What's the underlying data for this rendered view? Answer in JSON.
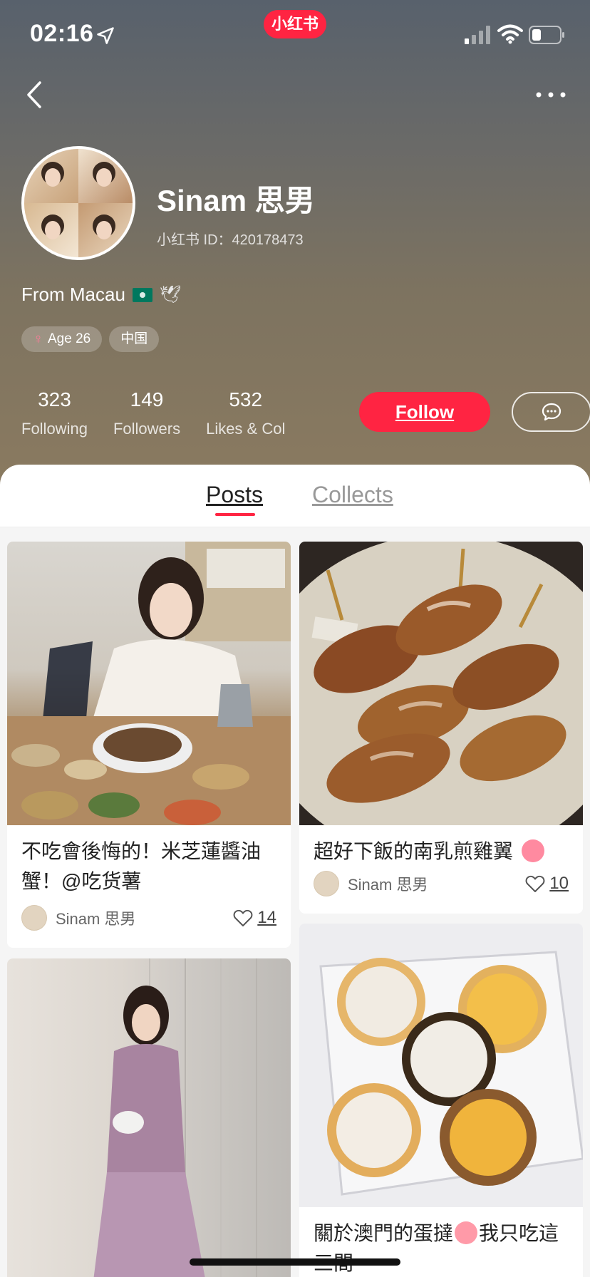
{
  "status_bar": {
    "time": "02:16",
    "app_logo_text": "小红书"
  },
  "profile": {
    "name": "Sinam 思男",
    "id_text": "小红书 ID：420178473",
    "bio": "From Macau",
    "tags": {
      "age": "Age 26",
      "region": "中国"
    },
    "stats": [
      {
        "value": "323",
        "label": "Following"
      },
      {
        "value": "149",
        "label": "Followers"
      },
      {
        "value": "532",
        "label": "Likes & Col"
      }
    ],
    "follow_label": "Follow"
  },
  "tabs": {
    "posts": "Posts",
    "collects": "Collects"
  },
  "posts": [
    {
      "title": "不吃會後悔的！米芝蓮醬油蟹！@吃货薯",
      "author": "Sinam 思男",
      "likes": "14"
    },
    {
      "title": "超好下飯的南乳煎雞翼",
      "author": "Sinam 思男",
      "likes": "10"
    },
    {
      "title": ""
    },
    {
      "title": "關於澳門的蛋撻",
      "title_suffix": "我只吃這三間"
    }
  ],
  "icons": {
    "back": "chevron-left-icon",
    "more": "more-dots-icon",
    "message": "chat-bubble-icon",
    "like": "heart-outline-icon"
  },
  "colors": {
    "brand": "#ff2442"
  }
}
